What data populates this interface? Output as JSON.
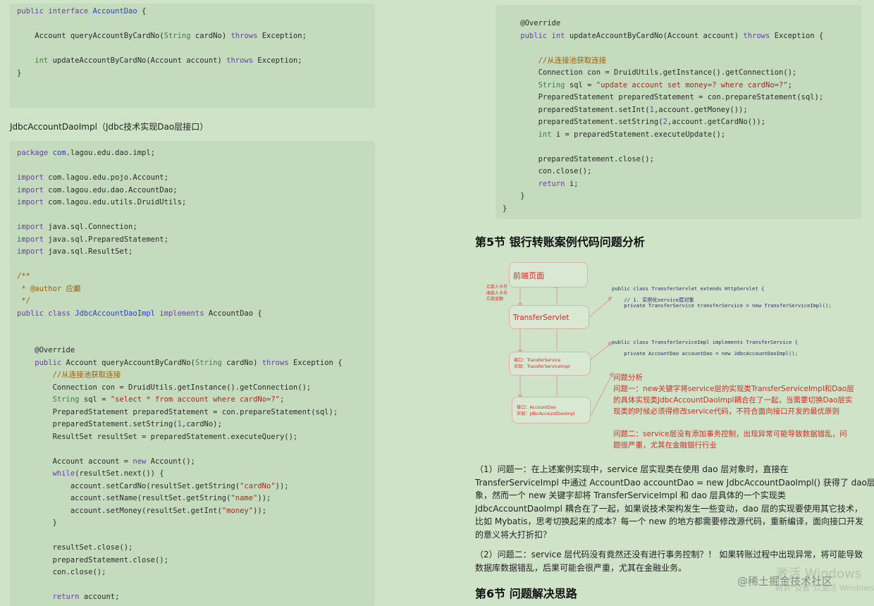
{
  "left_code_top": [
    [
      [
        "kw",
        "public interface "
      ],
      [
        "cls",
        "AccountDao"
      ],
      [
        "plain",
        " {"
      ]
    ],
    [],
    [
      [
        "plain",
        "    Account queryAccountByCardNo("
      ],
      [
        "ty",
        "String"
      ],
      [
        "plain",
        " cardNo) "
      ],
      [
        "kw",
        "throws"
      ],
      [
        "plain",
        " Exception;"
      ]
    ],
    [],
    [
      [
        "ty",
        "    int"
      ],
      [
        "plain",
        " updateAccountByCardNo(Account account) "
      ],
      [
        "kw",
        "throws"
      ],
      [
        "plain",
        " Exception;"
      ]
    ],
    [
      [
        "plain",
        "}"
      ]
    ]
  ],
  "caption_impl": "JdbcAccountDaoImpl（Jdbc技术实现Dao层接口）",
  "left_code_main": [
    [
      [
        "kw",
        "package "
      ],
      [
        "cls",
        "com"
      ],
      [
        "plain",
        ".lagou.edu.dao.impl;"
      ]
    ],
    [],
    [
      [
        "kw",
        "import"
      ],
      [
        "plain",
        " com.lagou.edu.pojo.Account;"
      ]
    ],
    [
      [
        "kw",
        "import"
      ],
      [
        "plain",
        " com.lagou.edu.dao.AccountDao;"
      ]
    ],
    [
      [
        "kw",
        "import"
      ],
      [
        "plain",
        " com.lagou.edu.utils.DruidUtils;"
      ]
    ],
    [],
    [
      [
        "kw",
        "import"
      ],
      [
        "plain",
        " java.sql.Connection;"
      ]
    ],
    [
      [
        "kw",
        "import"
      ],
      [
        "plain",
        " java.sql.PreparedStatement;"
      ]
    ],
    [
      [
        "kw",
        "import"
      ],
      [
        "plain",
        " java.sql.ResultSet;"
      ]
    ],
    [],
    [
      [
        "cm",
        "/**"
      ]
    ],
    [
      [
        "cm",
        " * @author 应癫"
      ]
    ],
    [
      [
        "cm",
        " */"
      ]
    ],
    [
      [
        "kw",
        "public class "
      ],
      [
        "cls",
        "JdbcAccountDaoImpl"
      ],
      [
        "kw",
        " implements "
      ],
      [
        "plain",
        "AccountDao {"
      ]
    ],
    [],
    [],
    [
      [
        "plain",
        "    @Override"
      ]
    ],
    [
      [
        "kw",
        "    public"
      ],
      [
        "plain",
        " Account queryAccountByCardNo("
      ],
      [
        "ty",
        "String"
      ],
      [
        "plain",
        " cardNo) "
      ],
      [
        "kw",
        "throws"
      ],
      [
        "plain",
        " Exception {"
      ]
    ],
    [
      [
        "cm",
        "        //从连接池获取连接"
      ]
    ],
    [
      [
        "plain",
        "        Connection con = DruidUtils.getInstance().getConnection();"
      ]
    ],
    [
      [
        "ty",
        "        String"
      ],
      [
        "plain",
        " sql = "
      ],
      [
        "str",
        "\"select * from account where cardNo=?\""
      ],
      [
        "plain",
        ";"
      ]
    ],
    [
      [
        "plain",
        "        PreparedStatement preparedStatement = con.prepareStatement(sql);"
      ]
    ],
    [
      [
        "plain",
        "        preparedStatement.setString("
      ],
      [
        "num",
        "1"
      ],
      [
        "plain",
        ",cardNo);"
      ]
    ],
    [
      [
        "plain",
        "        ResultSet resultSet = preparedStatement.executeQuery();"
      ]
    ],
    [],
    [
      [
        "plain",
        "        Account account = "
      ],
      [
        "kw",
        "new"
      ],
      [
        "plain",
        " Account();"
      ]
    ],
    [
      [
        "kw",
        "        while"
      ],
      [
        "plain",
        "(resultSet.next()) {"
      ]
    ],
    [
      [
        "plain",
        "            account.setCardNo(resultSet.getString("
      ],
      [
        "str",
        "\"cardNo\""
      ],
      [
        "plain",
        "));"
      ]
    ],
    [
      [
        "plain",
        "            account.setName(resultSet.getString("
      ],
      [
        "str",
        "\"name\""
      ],
      [
        "plain",
        "));"
      ]
    ],
    [
      [
        "plain",
        "            account.setMoney(resultSet.getInt("
      ],
      [
        "str",
        "\"money\""
      ],
      [
        "plain",
        "));"
      ]
    ],
    [
      [
        "plain",
        "        }"
      ]
    ],
    [],
    [
      [
        "plain",
        "        resultSet.close();"
      ]
    ],
    [
      [
        "plain",
        "        preparedStatement.close();"
      ]
    ],
    [
      [
        "plain",
        "        con.close();"
      ]
    ],
    [],
    [
      [
        "kw",
        "        return"
      ],
      [
        "plain",
        " account;"
      ]
    ]
  ],
  "right_code": [
    [
      [
        "plain",
        "    @Override"
      ]
    ],
    [
      [
        "kw",
        "    public int"
      ],
      [
        "plain",
        " updateAccountByCardNo(Account account) "
      ],
      [
        "kw",
        "throws"
      ],
      [
        "plain",
        " Exception {"
      ]
    ],
    [],
    [
      [
        "cm",
        "        //从连接池获取连接"
      ]
    ],
    [
      [
        "plain",
        "        Connection con = DruidUtils.getInstance().getConnection();"
      ]
    ],
    [
      [
        "ty",
        "        String"
      ],
      [
        "plain",
        " sql = "
      ],
      [
        "str",
        "\"update account set money=? where cardNo=?\""
      ],
      [
        "plain",
        ";"
      ]
    ],
    [
      [
        "plain",
        "        PreparedStatement preparedStatement = con.prepareStatement(sql);"
      ]
    ],
    [
      [
        "plain",
        "        preparedStatement.setInt("
      ],
      [
        "num",
        "1"
      ],
      [
        "plain",
        ",account.getMoney());"
      ]
    ],
    [
      [
        "plain",
        "        preparedStatement.setString("
      ],
      [
        "num",
        "2"
      ],
      [
        "plain",
        ",account.getCardNo());"
      ]
    ],
    [
      [
        "ty",
        "        int"
      ],
      [
        "plain",
        " i = preparedStatement.executeUpdate();"
      ]
    ],
    [],
    [
      [
        "plain",
        "        preparedStatement.close();"
      ]
    ],
    [
      [
        "plain",
        "        con.close();"
      ]
    ],
    [
      [
        "kw",
        "        return"
      ],
      [
        "plain",
        " i;"
      ]
    ],
    [
      [
        "plain",
        "    }"
      ]
    ],
    [
      [
        "plain",
        "}"
      ]
    ]
  ],
  "section5_title": "第5节 银行转账案例代码问题分析",
  "diagram": {
    "box_front": "前端页面",
    "box_servlet": "TransferServlet",
    "params": "汇款人卡号\n收款人卡号\n汇款金额",
    "box_service": "接口：TransferService\n实现：TransferServiceImpl",
    "box_dao": "接口：AccountDao\n实现：JdbcAccountDaoImpl",
    "code1": "public class TransferServlet extends HttpServlet {\n\n    // 1. 实例化service层对象\n    private TransferService transferService = new TransferServiceImpl();",
    "code2": "public class TransferServiceImpl implements TransferService {\n\n    private AccountDao accountDao = new JdbcAccountDaoImpl();",
    "notes": "问题分析\n问题一：new关键字将service层的实现类TransferServiceImpl和Dao层\n的具体实现类JdbcAccountDaoImpl耦合在了一起，当需要切换Dao层实\n现类的时候必须得修改service代码，不符合面向接口开发的最优原则\n\n问题二：service层没有添加事务控制，出现异常可能导致数据错乱，问\n题很严重，尤其在金融银行行业"
  },
  "para1": "（1）问题一：在上述案例实现中，service 层实现类在使用 dao 层对象时，直接在\nTransferServiceImpl 中通过 AccountDao accountDao = new JdbcAccountDaoImpl() 获得了 dao层对\n象，然而一个 new 关键字却将 TransferServiceImpl 和 dao 层具体的一个实现类\nJdbcAccountDaoImpl 耦合在了一起，如果说技术架构发生一些变动，dao 层的实现要使用其它技术，\n比如 Mybatis，思考切换起来的成本？每一个 new 的地方都需要修改源代码，重新编译，面向接口开发\n的意义将大打折扣？",
  "para2": "（2）问题二：service 层代码没有竟然还没有进行事务控制？！ 如果转账过程中出现异常，将可能导致\n数据库数据错乱，后果可能会很严重，尤其在金融业务。",
  "section6_title": "第6节 问题解决思路",
  "watermark_windows": "激活 Windows",
  "watermark_goto": "转到\"设置\"以激活 Windows。",
  "watermark_site": "@稀土掘金技术社区",
  "colors": {
    "background": "#cfe3c9",
    "code_bg": "#c4dbbd",
    "diagram_red": "#d62b24"
  }
}
